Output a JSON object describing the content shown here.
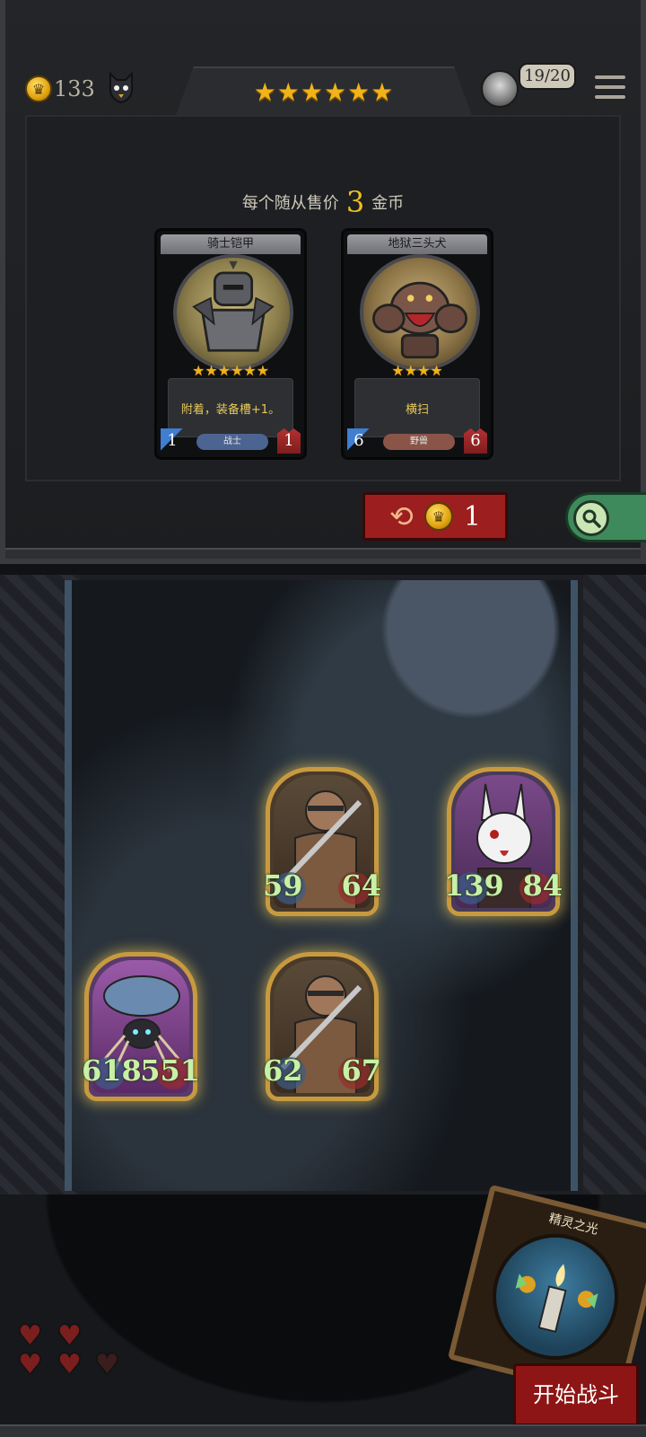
{
  "hud": {
    "gold": "133",
    "coin_symbol": "♛",
    "stars": "★★★★★★",
    "capacity": "19/20"
  },
  "shop": {
    "sell_prefix": "每个随从售价",
    "sell_price": "3",
    "sell_suffix": "金币",
    "cards": [
      {
        "name": "骑士铠甲",
        "stars": "★★★★★★",
        "description": "附着，装备槽+1。",
        "attack": "1",
        "health": "1",
        "tribe": "战士"
      },
      {
        "name": "地狱三头犬",
        "stars": "★★★★",
        "description": "横扫",
        "attack": "6",
        "health": "6",
        "tribe": "野兽"
      }
    ],
    "refresh": {
      "icon": "⟲",
      "cost": "1"
    }
  },
  "board": {
    "units": [
      {
        "attack": "59",
        "health": "64"
      },
      {
        "attack": "139",
        "health": "84"
      },
      {
        "attack": "618",
        "health": "551"
      },
      {
        "attack": "62",
        "health": "67"
      }
    ]
  },
  "player": {
    "hearts": [
      "full",
      "full",
      "full",
      "full",
      "empty"
    ]
  },
  "spell_card": {
    "name": "精灵之光"
  },
  "start_battle": {
    "label": "开始战斗"
  },
  "colors": {
    "gold": "#f0c019",
    "accent_red": "#9d1e1e",
    "stat_green": "#c8f0a6",
    "unit_frame": "#c89a40"
  }
}
